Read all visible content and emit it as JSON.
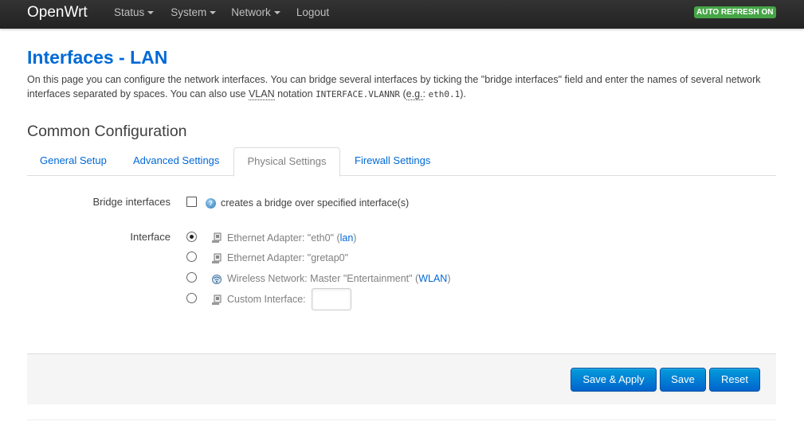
{
  "navbar": {
    "brand": "OpenWrt",
    "menu": [
      {
        "label": "Status",
        "dropdown": true
      },
      {
        "label": "System",
        "dropdown": true
      },
      {
        "label": "Network",
        "dropdown": true
      },
      {
        "label": "Logout",
        "dropdown": false
      }
    ],
    "refresh_badge": "AUTO REFRESH ON",
    "badge_color": "#46a546"
  },
  "page": {
    "title": "Interfaces - LAN",
    "desc_part1": "On this page you can configure the network interfaces. You can bridge several interfaces by ticking the \"bridge interfaces\" field and enter the names of several network interfaces separated by spaces. You can also use ",
    "desc_abbr": "VLAN",
    "desc_part2": " notation ",
    "desc_code1": "INTERFACE.VLANNR",
    "desc_part3": " (",
    "desc_eg": "e.g.",
    "desc_part4": ": ",
    "desc_code2": "eth0.1",
    "desc_part5": ").",
    "section_title": "Common Configuration",
    "accent_color": "#0069d6"
  },
  "tabs": [
    {
      "label": "General Setup",
      "active": false
    },
    {
      "label": "Advanced Settings",
      "active": false
    },
    {
      "label": "Physical Settings",
      "active": true
    },
    {
      "label": "Firewall Settings",
      "active": false
    }
  ],
  "form": {
    "bridge_label": "Bridge interfaces",
    "bridge_checked": false,
    "bridge_help": "creates a bridge over specified interface(s)",
    "interface_label": "Interface",
    "options": [
      {
        "text": "Ethernet Adapter: \"eth0\" (",
        "link": "lan",
        "suffix": ")",
        "icon": "ethernet-icon",
        "checked": true
      },
      {
        "text": "Ethernet Adapter: \"gretap0\"",
        "link": "",
        "suffix": "",
        "icon": "ethernet-icon",
        "checked": false
      },
      {
        "text": "Wireless Network: Master \"Entertainment\" (",
        "link": "WLAN",
        "suffix": ")",
        "icon": "wifi-icon",
        "checked": false
      },
      {
        "text": "Custom Interface:",
        "link": "",
        "suffix": "",
        "icon": "ethernet-icon",
        "checked": false,
        "input_value": ""
      }
    ]
  },
  "actions": {
    "save_apply": "Save & Apply",
    "save": "Save",
    "reset": "Reset",
    "button_color": "#0069d6"
  }
}
